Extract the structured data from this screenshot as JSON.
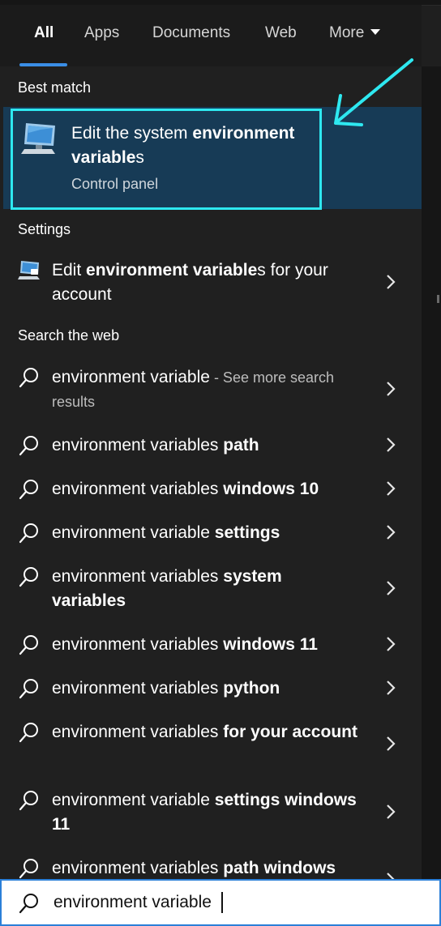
{
  "tabs": [
    {
      "label": "All",
      "active": true
    },
    {
      "label": "Apps"
    },
    {
      "label": "Documents"
    },
    {
      "label": "Web"
    },
    {
      "label": "More"
    }
  ],
  "sections": {
    "best_match": "Best match",
    "settings": "Settings",
    "search_web": "Search the web"
  },
  "best_match": {
    "title_plain": "Edit the system ",
    "title_bold": "environment variable",
    "title_tail": "s",
    "subtitle": "Control panel",
    "icon": "monitor-icon"
  },
  "settings_item": {
    "plain": "Edit ",
    "bold": "environment variable",
    "tail": "s for your account",
    "icon": "settings-monitor-icon"
  },
  "web_first": {
    "plain": "environment variable",
    "see_more": " - See more search results"
  },
  "web_items": [
    {
      "plain": "environment variables ",
      "bold": "path"
    },
    {
      "plain": "environment variables ",
      "bold": "windows 10"
    },
    {
      "plain": "environment variable ",
      "bold": "settings"
    },
    {
      "plain": "environment variables ",
      "bold": "system variables"
    },
    {
      "plain": "environment variables ",
      "bold": "windows 11"
    },
    {
      "plain": "environment variables ",
      "bold": "python"
    },
    {
      "plain": "environment variables ",
      "bold": "for your account"
    },
    {
      "plain": "environment variable ",
      "bold": "settings windows 11"
    },
    {
      "plain": "environment variables ",
      "bold": "path windows"
    }
  ],
  "search": {
    "value": "environment variable",
    "icon": "search-icon"
  },
  "colors": {
    "highlight_box": "#2ee8f0",
    "annotation_arrow": "#2ee8f0",
    "selected_bg": "#173b56",
    "tab_underline": "#3a8ee6"
  }
}
